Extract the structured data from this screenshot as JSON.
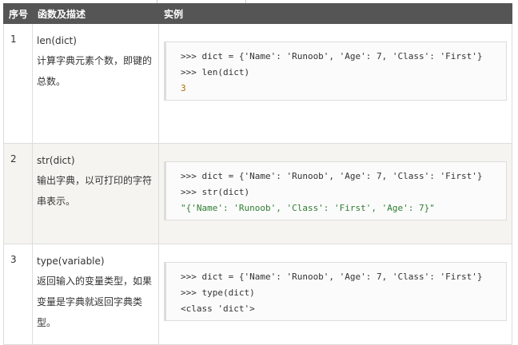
{
  "header": {
    "col_num": "序号",
    "col_func": "函数及描述",
    "col_example": "实例"
  },
  "rows": [
    {
      "num": "1",
      "func": "len(dict)",
      "desc": "计算字典元素个数，即键的总数。",
      "code": [
        ">>> dict = {'Name': 'Runoob', 'Age': 7, 'Class': 'First'}",
        ">>> len(dict)",
        "3"
      ]
    },
    {
      "num": "2",
      "func": "str(dict)",
      "desc": "输出字典，以可打印的字符串表示。",
      "code": [
        ">>> dict = {'Name': 'Runoob', 'Age': 7, 'Class': 'First'}",
        ">>> str(dict)",
        "\"{'Name': 'Runoob', 'Class': 'First', 'Age': 7}\""
      ]
    },
    {
      "num": "3",
      "func": "type(variable)",
      "desc": "返回输入的变量类型，如果变量是字典就返回字典类型。",
      "code": [
        ">>> dict = {'Name': 'Runoob', 'Age': 7, 'Class': 'First'}",
        ">>> type(dict)",
        "<class 'dict'>"
      ]
    }
  ],
  "colors": {
    "header_bg": "#555555",
    "row_alt_bg": "#f6f4f0",
    "string_color": "#2e7d32"
  }
}
